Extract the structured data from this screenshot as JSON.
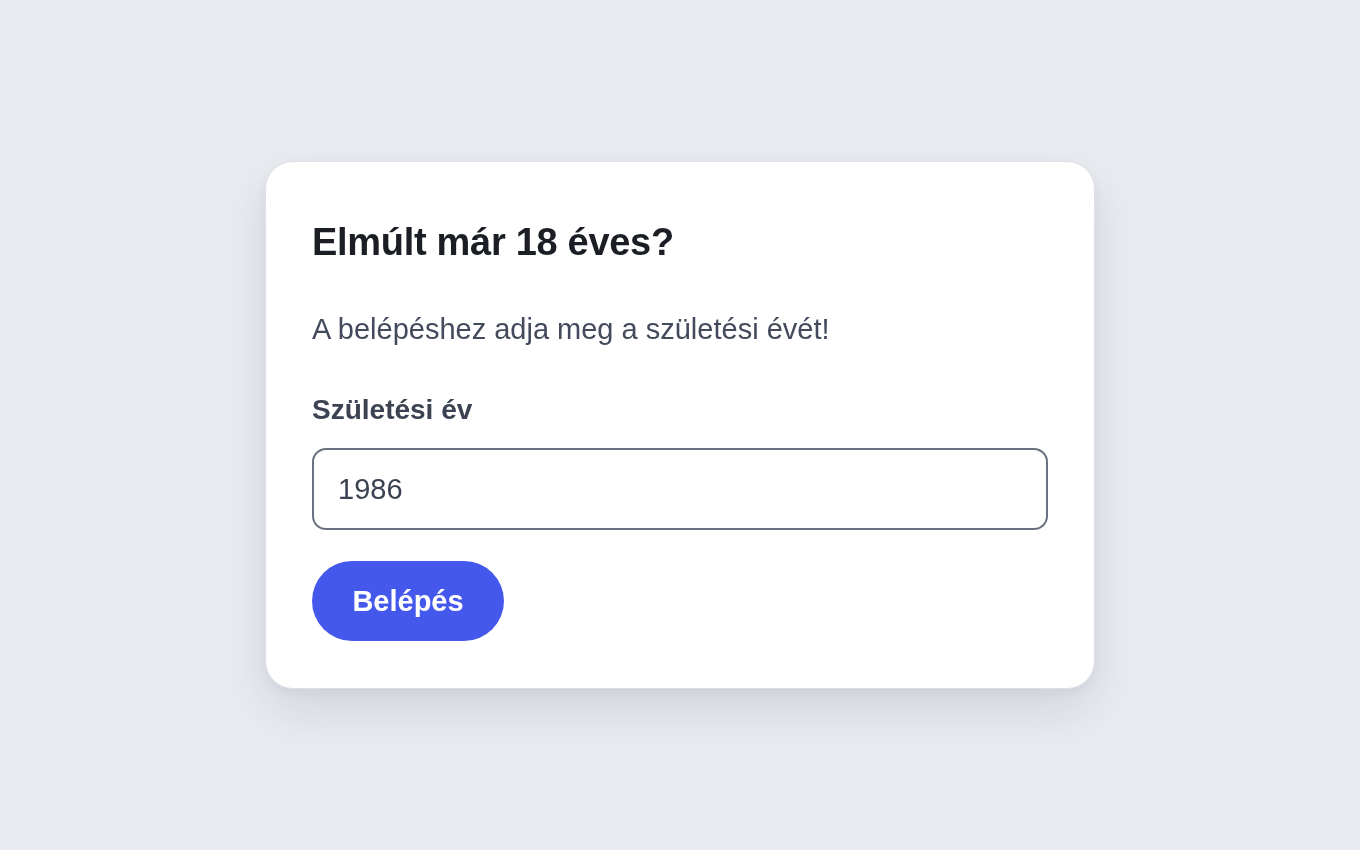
{
  "dialog": {
    "title": "Elmúlt már 18 éves?",
    "prompt": "A belépéshez adja meg a születési évét!",
    "field": {
      "label": "Születési év",
      "value": "1986"
    },
    "button": {
      "label": "Belépés"
    }
  }
}
